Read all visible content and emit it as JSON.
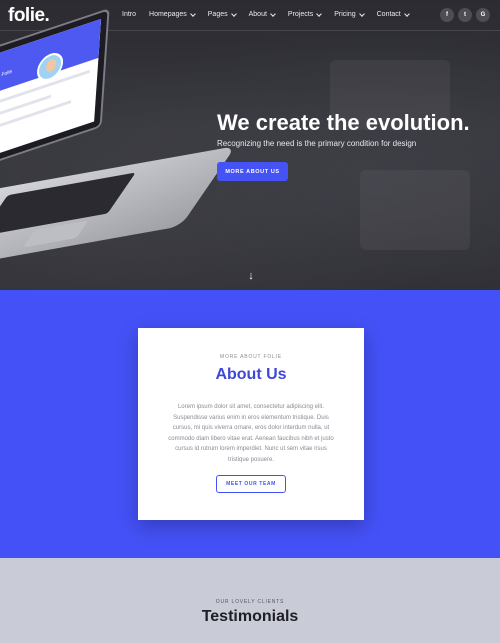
{
  "brand": {
    "logo": "folie."
  },
  "nav": {
    "items": [
      {
        "label": "Intro",
        "has_dropdown": false
      },
      {
        "label": "Homepages",
        "has_dropdown": true
      },
      {
        "label": "Pages",
        "has_dropdown": true
      },
      {
        "label": "About",
        "has_dropdown": true
      },
      {
        "label": "Projects",
        "has_dropdown": true
      },
      {
        "label": "Pricing",
        "has_dropdown": true
      },
      {
        "label": "Contact",
        "has_dropdown": true
      }
    ],
    "socials": [
      {
        "icon": "facebook-icon",
        "glyph": "f"
      },
      {
        "icon": "twitter-icon",
        "glyph": "t"
      },
      {
        "icon": "google-icon",
        "glyph": "G"
      }
    ]
  },
  "hero": {
    "title": "We create the evolution.",
    "subtitle": "Recognizing the need is the primary condition for design",
    "button_label": "MORE ABOUT US",
    "laptop_screen_text": "Welcome to Folie",
    "scroll_arrow": "↓"
  },
  "about": {
    "kicker": "MORE ABOUT FOLIE",
    "title": "About Us",
    "text": "Lorem ipsum dolor sit amet, consectetur adipiscing elit. Suspendisse varius enim in eros elementum tristique. Duis cursus, mi quis viverra ornare, eros dolor interdum nulla, ut commodo diam libero vitae erat. Aenean faucibus nibh et justo cursus id rutrum lorem imperdiet. Nunc ut sem vitae risus tristique posuere.",
    "button_label": "MEET OUR TEAM"
  },
  "testimonials": {
    "kicker": "OUR LOVELY CLIENTS",
    "title": "Testimonials"
  },
  "colors": {
    "accent": "#4451f6",
    "hero_bg": "#2e2e34",
    "testimonials_bg": "#c9ccd7"
  }
}
